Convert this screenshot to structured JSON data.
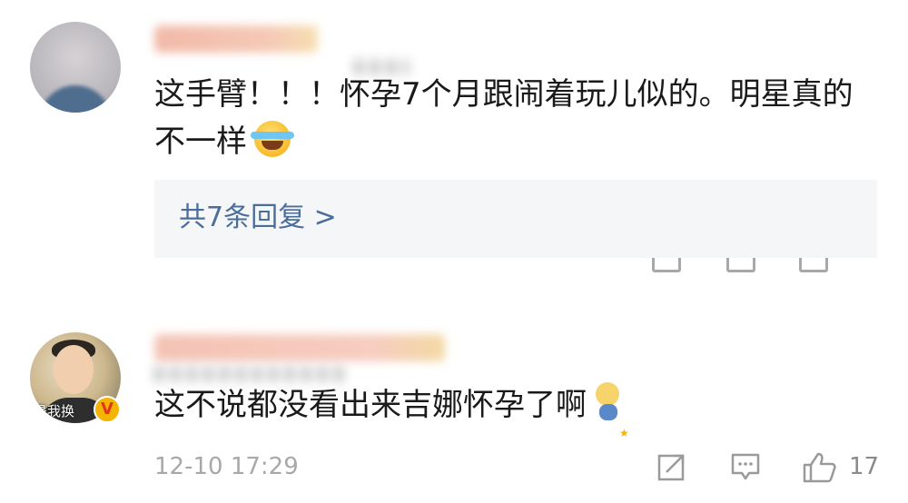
{
  "comments": [
    {
      "text": "这手臂！！！怀孕7个月跟闹着玩儿似的。明星真的不一样",
      "emoji": "laughing-crying-emoji",
      "reply": {
        "label": "共7条回复 >"
      }
    },
    {
      "avatar_overlay": "是我换",
      "text": "这不说都没看出来吉娜怀孕了啊",
      "emoji": "sitting-figure-emoji",
      "time": "12-10 17:29",
      "like_count": "17"
    }
  ],
  "colors": {
    "text": "#1a1a1a",
    "reply_link": "#4a6d9a",
    "reply_bg": "#f5f6f7",
    "meta": "#a8a8a8",
    "verified_badge": "#f5b400"
  }
}
